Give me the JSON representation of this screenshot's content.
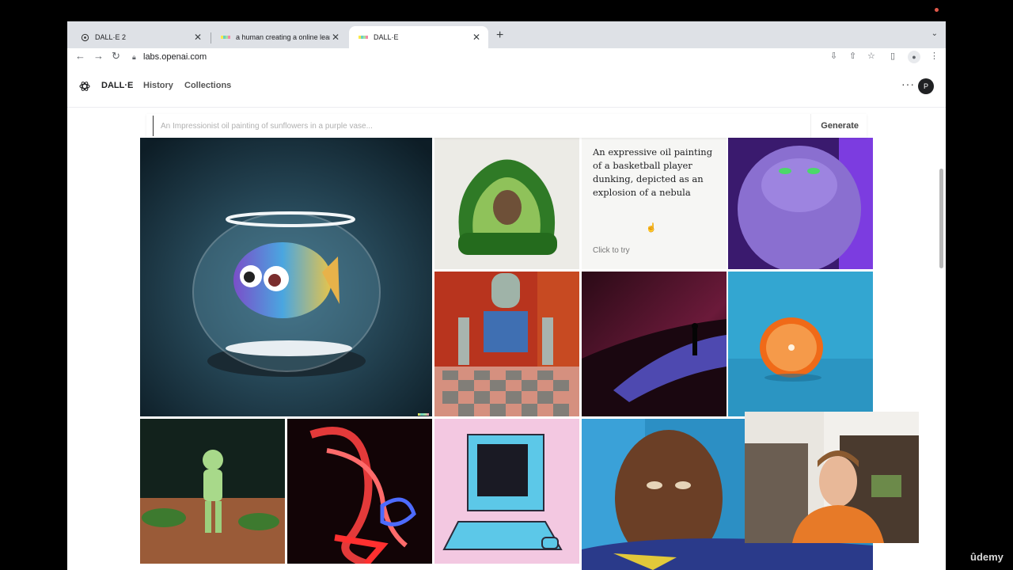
{
  "browser": {
    "tabs": [
      {
        "title": "DALL·E 2",
        "favicon": "openai-icon",
        "active": false
      },
      {
        "title": "a human creating a online learn",
        "favicon": "dalle-stripe-icon",
        "active": false
      },
      {
        "title": "DALL·E",
        "favicon": "dalle-stripe-icon",
        "active": true
      }
    ],
    "new_tab": "+",
    "url": "labs.openai.com"
  },
  "app": {
    "brand": "DALL·E",
    "nav": [
      "History",
      "Collections"
    ],
    "avatar_initial": "P"
  },
  "prompt": {
    "placeholder": "An Impressionist oil painting of sunflowers in a purple vase...",
    "generate_label": "Generate"
  },
  "gallery": {
    "featured_prompt": "An expressive oil painting of a basketball player dunking, depicted as an explosion of a nebula",
    "click_to_try": "Click to try",
    "images": [
      "fishbowl",
      "avocado-chair",
      "purple-monster",
      "robot-chess",
      "dark-landscape-figure",
      "orange-slice",
      "green-astronaut",
      "neon-face",
      "retro-computer",
      "portrait-painting"
    ]
  },
  "overlay": {
    "watermark": "ûdemy"
  },
  "colors": {
    "tabstrip": "#dee1e6",
    "accent_dark": "#202123"
  }
}
